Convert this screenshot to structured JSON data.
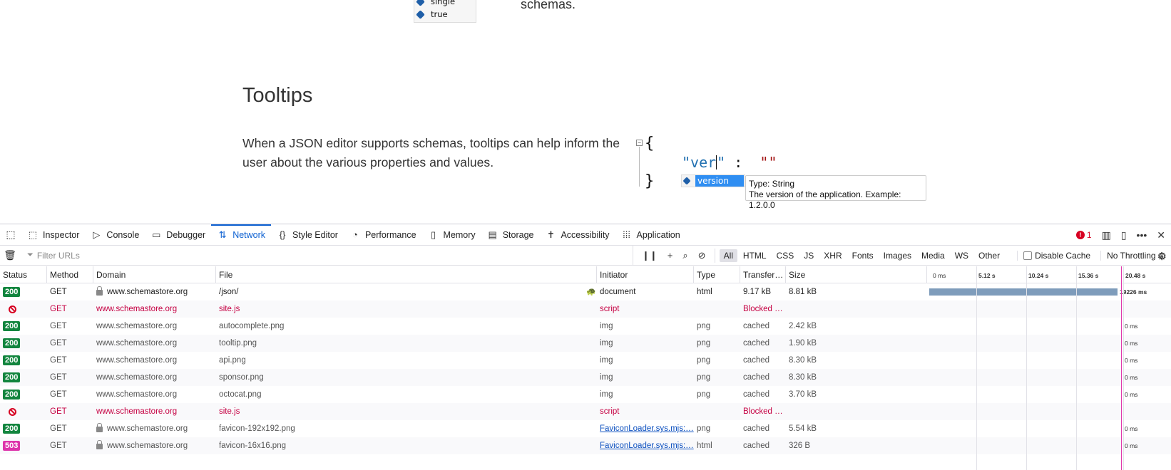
{
  "page": {
    "autocomplete_top": [
      "single",
      "true"
    ],
    "schemas_text": "schemas.",
    "heading": "Tooltips",
    "paragraph": "When a JSON editor supports schemas, tooltips can help inform the user about the various properties and values.",
    "editor": {
      "fold_symbol": "−",
      "open_brace": "{",
      "close_brace": "}",
      "key_before_cursor": "\"ver",
      "key_after_cursor": "\"",
      "colon": ":",
      "value": "\"\""
    },
    "suggestion": "version",
    "tooltip": {
      "line1": "Type: String",
      "line2": "The version of the application. Example: 1.2.0.0"
    }
  },
  "devtools": {
    "tabs": [
      {
        "label": "Inspector",
        "icon": "inspector-icon",
        "glyph": "⬚"
      },
      {
        "label": "Console",
        "icon": "console-icon",
        "glyph": "▷"
      },
      {
        "label": "Debugger",
        "icon": "debugger-icon",
        "glyph": "▭"
      },
      {
        "label": "Network",
        "icon": "network-icon",
        "glyph": "⇅"
      },
      {
        "label": "Style Editor",
        "icon": "style-editor-icon",
        "glyph": "{}"
      },
      {
        "label": "Performance",
        "icon": "performance-icon",
        "glyph": "◔"
      },
      {
        "label": "Memory",
        "icon": "memory-icon",
        "glyph": "▯"
      },
      {
        "label": "Storage",
        "icon": "storage-icon",
        "glyph": "▤"
      },
      {
        "label": "Accessibility",
        "icon": "accessibility-icon",
        "glyph": "✝"
      },
      {
        "label": "Application",
        "icon": "application-icon",
        "glyph": "⁞⁞⁞"
      }
    ],
    "active_tab": "Network",
    "error_count": "1",
    "filter_placeholder": "Filter URLs",
    "type_filters": [
      "All",
      "HTML",
      "CSS",
      "JS",
      "XHR",
      "Fonts",
      "Images",
      "Media",
      "WS",
      "Other"
    ],
    "active_type_filter": "All",
    "disable_cache_label": "Disable Cache",
    "throttling_label": "No Throttling ⇕",
    "columns": [
      "Status",
      "Method",
      "Domain",
      "File",
      "Initiator",
      "Type",
      "Transfer…",
      "Size"
    ],
    "waterfall_ticks": [
      "0 ms",
      "5.12 s",
      "10.24 s",
      "15.36 s",
      "20.48 s"
    ],
    "colors": {
      "accent": "#0b5fd1",
      "status_ok": "#12853e",
      "status_503": "#dd33aa",
      "blocked": "#c50042",
      "waterfall_bar": "#7e9cbb",
      "marker": "#e036a9"
    },
    "requests": [
      {
        "status": "200",
        "blocked": false,
        "method": "GET",
        "secure": true,
        "domain": "www.schemastore.org",
        "file": "/json/",
        "initiator": "document",
        "initiator_link": false,
        "type": "html",
        "transfer": "9.17 kB",
        "size": "8.81 kB",
        "timing": "19226 ms",
        "bar": true
      },
      {
        "status": "",
        "blocked": true,
        "method": "GET",
        "secure": false,
        "domain": "www.schemastore.org",
        "file": "site.js",
        "initiator": "script",
        "initiator_link": false,
        "type": "",
        "transfer": "Blocked …",
        "size": "",
        "timing": "",
        "bar": false
      },
      {
        "status": "200",
        "blocked": false,
        "method": "GET",
        "secure": false,
        "domain": "www.schemastore.org",
        "file": "autocomplete.png",
        "initiator": "img",
        "initiator_link": false,
        "type": "png",
        "transfer": "cached",
        "size": "2.42 kB",
        "timing": "0 ms",
        "bar": false
      },
      {
        "status": "200",
        "blocked": false,
        "method": "GET",
        "secure": false,
        "domain": "www.schemastore.org",
        "file": "tooltip.png",
        "initiator": "img",
        "initiator_link": false,
        "type": "png",
        "transfer": "cached",
        "size": "1.90 kB",
        "timing": "0 ms",
        "bar": false
      },
      {
        "status": "200",
        "blocked": false,
        "method": "GET",
        "secure": false,
        "domain": "www.schemastore.org",
        "file": "api.png",
        "initiator": "img",
        "initiator_link": false,
        "type": "png",
        "transfer": "cached",
        "size": "8.30 kB",
        "timing": "0 ms",
        "bar": false
      },
      {
        "status": "200",
        "blocked": false,
        "method": "GET",
        "secure": false,
        "domain": "www.schemastore.org",
        "file": "sponsor.png",
        "initiator": "img",
        "initiator_link": false,
        "type": "png",
        "transfer": "cached",
        "size": "8.30 kB",
        "timing": "0 ms",
        "bar": false
      },
      {
        "status": "200",
        "blocked": false,
        "method": "GET",
        "secure": false,
        "domain": "www.schemastore.org",
        "file": "octocat.png",
        "initiator": "img",
        "initiator_link": false,
        "type": "png",
        "transfer": "cached",
        "size": "3.70 kB",
        "timing": "0 ms",
        "bar": false
      },
      {
        "status": "",
        "blocked": true,
        "method": "GET",
        "secure": false,
        "domain": "www.schemastore.org",
        "file": "site.js",
        "initiator": "script",
        "initiator_link": false,
        "type": "",
        "transfer": "Blocked …",
        "size": "",
        "timing": "",
        "bar": false
      },
      {
        "status": "200",
        "blocked": false,
        "method": "GET",
        "secure": true,
        "domain": "www.schemastore.org",
        "file": "favicon-192x192.png",
        "initiator": "FaviconLoader.sys.mjs:…",
        "initiator_link": true,
        "type": "png",
        "transfer": "cached",
        "size": "5.54 kB",
        "timing": "0 ms",
        "bar": false
      },
      {
        "status": "503",
        "blocked": false,
        "method": "GET",
        "secure": true,
        "domain": "www.schemastore.org",
        "file": "favicon-16x16.png",
        "initiator": "FaviconLoader.sys.mjs:…",
        "initiator_link": true,
        "type": "html",
        "transfer": "cached",
        "size": "326 B",
        "timing": "0 ms",
        "bar": false
      }
    ]
  }
}
